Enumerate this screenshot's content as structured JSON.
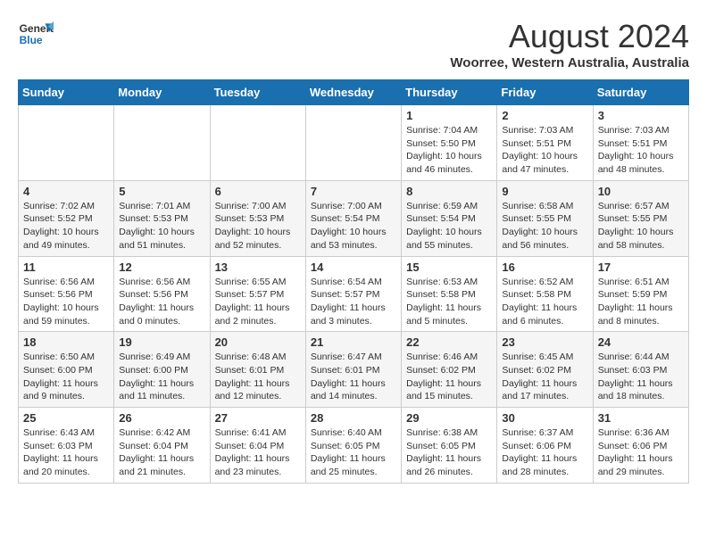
{
  "logo": {
    "line1": "General",
    "line2": "Blue"
  },
  "title": "August 2024",
  "subtitle": "Woorree, Western Australia, Australia",
  "days_of_week": [
    "Sunday",
    "Monday",
    "Tuesday",
    "Wednesday",
    "Thursday",
    "Friday",
    "Saturday"
  ],
  "weeks": [
    [
      {
        "day": "",
        "detail": ""
      },
      {
        "day": "",
        "detail": ""
      },
      {
        "day": "",
        "detail": ""
      },
      {
        "day": "",
        "detail": ""
      },
      {
        "day": "1",
        "detail": "Sunrise: 7:04 AM\nSunset: 5:50 PM\nDaylight: 10 hours\nand 46 minutes."
      },
      {
        "day": "2",
        "detail": "Sunrise: 7:03 AM\nSunset: 5:51 PM\nDaylight: 10 hours\nand 47 minutes."
      },
      {
        "day": "3",
        "detail": "Sunrise: 7:03 AM\nSunset: 5:51 PM\nDaylight: 10 hours\nand 48 minutes."
      }
    ],
    [
      {
        "day": "4",
        "detail": "Sunrise: 7:02 AM\nSunset: 5:52 PM\nDaylight: 10 hours\nand 49 minutes."
      },
      {
        "day": "5",
        "detail": "Sunrise: 7:01 AM\nSunset: 5:53 PM\nDaylight: 10 hours\nand 51 minutes."
      },
      {
        "day": "6",
        "detail": "Sunrise: 7:00 AM\nSunset: 5:53 PM\nDaylight: 10 hours\nand 52 minutes."
      },
      {
        "day": "7",
        "detail": "Sunrise: 7:00 AM\nSunset: 5:54 PM\nDaylight: 10 hours\nand 53 minutes."
      },
      {
        "day": "8",
        "detail": "Sunrise: 6:59 AM\nSunset: 5:54 PM\nDaylight: 10 hours\nand 55 minutes."
      },
      {
        "day": "9",
        "detail": "Sunrise: 6:58 AM\nSunset: 5:55 PM\nDaylight: 10 hours\nand 56 minutes."
      },
      {
        "day": "10",
        "detail": "Sunrise: 6:57 AM\nSunset: 5:55 PM\nDaylight: 10 hours\nand 58 minutes."
      }
    ],
    [
      {
        "day": "11",
        "detail": "Sunrise: 6:56 AM\nSunset: 5:56 PM\nDaylight: 10 hours\nand 59 minutes."
      },
      {
        "day": "12",
        "detail": "Sunrise: 6:56 AM\nSunset: 5:56 PM\nDaylight: 11 hours\nand 0 minutes."
      },
      {
        "day": "13",
        "detail": "Sunrise: 6:55 AM\nSunset: 5:57 PM\nDaylight: 11 hours\nand 2 minutes."
      },
      {
        "day": "14",
        "detail": "Sunrise: 6:54 AM\nSunset: 5:57 PM\nDaylight: 11 hours\nand 3 minutes."
      },
      {
        "day": "15",
        "detail": "Sunrise: 6:53 AM\nSunset: 5:58 PM\nDaylight: 11 hours\nand 5 minutes."
      },
      {
        "day": "16",
        "detail": "Sunrise: 6:52 AM\nSunset: 5:58 PM\nDaylight: 11 hours\nand 6 minutes."
      },
      {
        "day": "17",
        "detail": "Sunrise: 6:51 AM\nSunset: 5:59 PM\nDaylight: 11 hours\nand 8 minutes."
      }
    ],
    [
      {
        "day": "18",
        "detail": "Sunrise: 6:50 AM\nSunset: 6:00 PM\nDaylight: 11 hours\nand 9 minutes."
      },
      {
        "day": "19",
        "detail": "Sunrise: 6:49 AM\nSunset: 6:00 PM\nDaylight: 11 hours\nand 11 minutes."
      },
      {
        "day": "20",
        "detail": "Sunrise: 6:48 AM\nSunset: 6:01 PM\nDaylight: 11 hours\nand 12 minutes."
      },
      {
        "day": "21",
        "detail": "Sunrise: 6:47 AM\nSunset: 6:01 PM\nDaylight: 11 hours\nand 14 minutes."
      },
      {
        "day": "22",
        "detail": "Sunrise: 6:46 AM\nSunset: 6:02 PM\nDaylight: 11 hours\nand 15 minutes."
      },
      {
        "day": "23",
        "detail": "Sunrise: 6:45 AM\nSunset: 6:02 PM\nDaylight: 11 hours\nand 17 minutes."
      },
      {
        "day": "24",
        "detail": "Sunrise: 6:44 AM\nSunset: 6:03 PM\nDaylight: 11 hours\nand 18 minutes."
      }
    ],
    [
      {
        "day": "25",
        "detail": "Sunrise: 6:43 AM\nSunset: 6:03 PM\nDaylight: 11 hours\nand 20 minutes."
      },
      {
        "day": "26",
        "detail": "Sunrise: 6:42 AM\nSunset: 6:04 PM\nDaylight: 11 hours\nand 21 minutes."
      },
      {
        "day": "27",
        "detail": "Sunrise: 6:41 AM\nSunset: 6:04 PM\nDaylight: 11 hours\nand 23 minutes."
      },
      {
        "day": "28",
        "detail": "Sunrise: 6:40 AM\nSunset: 6:05 PM\nDaylight: 11 hours\nand 25 minutes."
      },
      {
        "day": "29",
        "detail": "Sunrise: 6:38 AM\nSunset: 6:05 PM\nDaylight: 11 hours\nand 26 minutes."
      },
      {
        "day": "30",
        "detail": "Sunrise: 6:37 AM\nSunset: 6:06 PM\nDaylight: 11 hours\nand 28 minutes."
      },
      {
        "day": "31",
        "detail": "Sunrise: 6:36 AM\nSunset: 6:06 PM\nDaylight: 11 hours\nand 29 minutes."
      }
    ]
  ]
}
